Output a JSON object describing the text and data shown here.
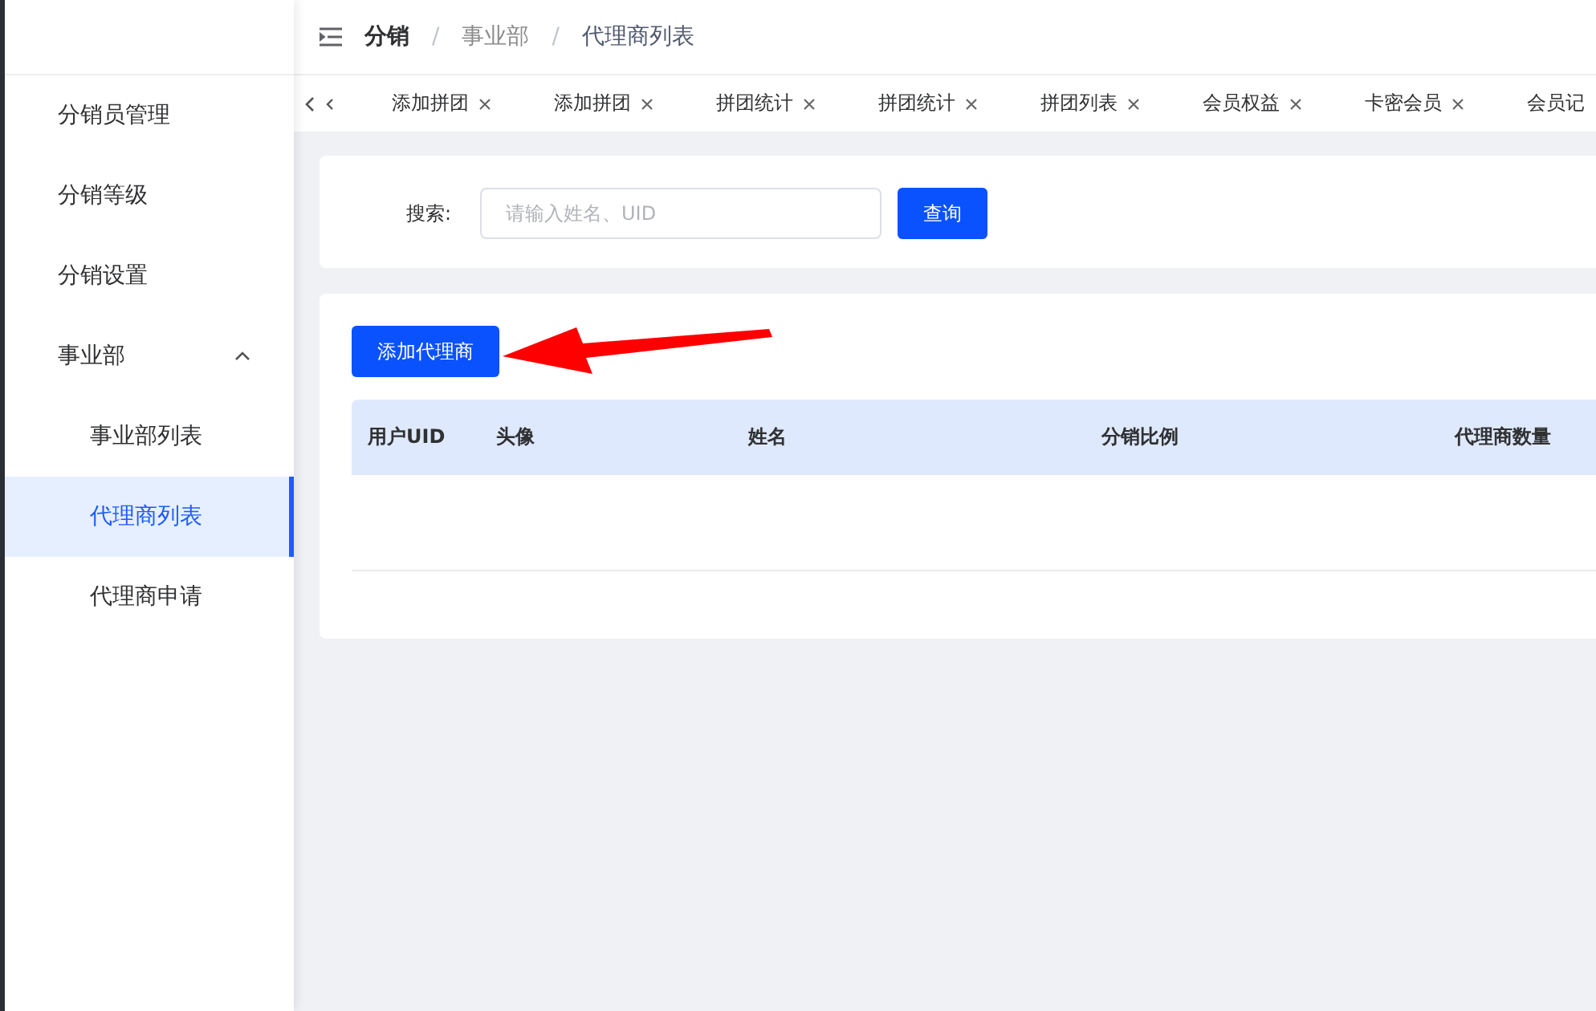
{
  "sidebar": {
    "items": [
      {
        "label": "分销员管理",
        "selected": false
      },
      {
        "label": "分销等级",
        "selected": false
      },
      {
        "label": "分销设置",
        "selected": false
      },
      {
        "label": "事业部",
        "selected": false,
        "expanded": true,
        "children": [
          {
            "label": "事业部列表",
            "selected": false
          },
          {
            "label": "代理商列表",
            "selected": true
          },
          {
            "label": "代理商申请",
            "selected": false
          }
        ]
      }
    ]
  },
  "breadcrumb": [
    "分销",
    "事业部",
    "代理商列表"
  ],
  "breadcrumb_separator": "/",
  "tabs": [
    {
      "label": "添加拼团",
      "closable": true
    },
    {
      "label": "添加拼团",
      "closable": true
    },
    {
      "label": "拼团统计",
      "closable": true
    },
    {
      "label": "拼团统计",
      "closable": true
    },
    {
      "label": "拼团列表",
      "closable": true
    },
    {
      "label": "会员权益",
      "closable": true
    },
    {
      "label": "卡密会员",
      "closable": true
    },
    {
      "label": "会员记",
      "closable": false
    }
  ],
  "search": {
    "label": "搜索:",
    "placeholder": "请输入姓名、UID",
    "button": "查询"
  },
  "add_button": "添加代理商",
  "table": {
    "columns": [
      "用户UID",
      "头像",
      "姓名",
      "分销比例",
      "代理商数量"
    ]
  }
}
